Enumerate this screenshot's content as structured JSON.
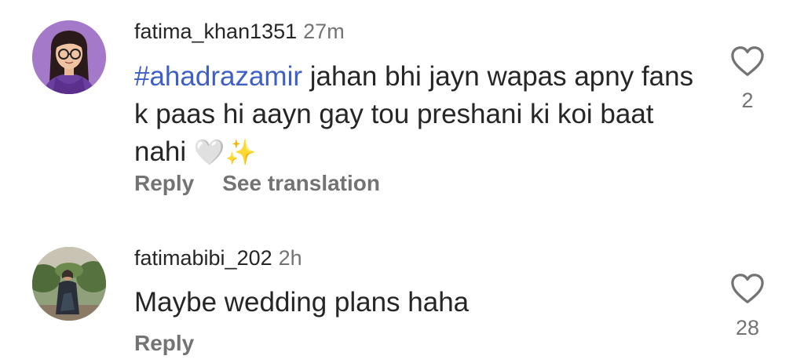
{
  "comments": [
    {
      "username": "fatima_khan1351",
      "time": "27m",
      "hashtag": "#ahadrazamir",
      "text": " jahan bhi jayn wapas apny fans k paas hi aayn gay tou preshani ki koi baat nahi ",
      "emojis": [
        "🤍",
        "✨"
      ],
      "actions": [
        "Reply",
        "See translation"
      ],
      "like_count": "2",
      "avatar_icon": "avatar-illustrated-woman-glasses",
      "avatar_color": "#a579c9"
    },
    {
      "username": "fatimabibi_202",
      "time": "2h",
      "text": "Maybe wedding plans haha",
      "actions": [
        "Reply"
      ],
      "like_count": "28",
      "avatar_icon": "avatar-photo-woman-standing",
      "avatar_color": "#6d8a5a"
    }
  ],
  "colors": {
    "hashtag": "#3e5fc7",
    "secondary_text": "#737373",
    "primary_text": "#262626"
  }
}
